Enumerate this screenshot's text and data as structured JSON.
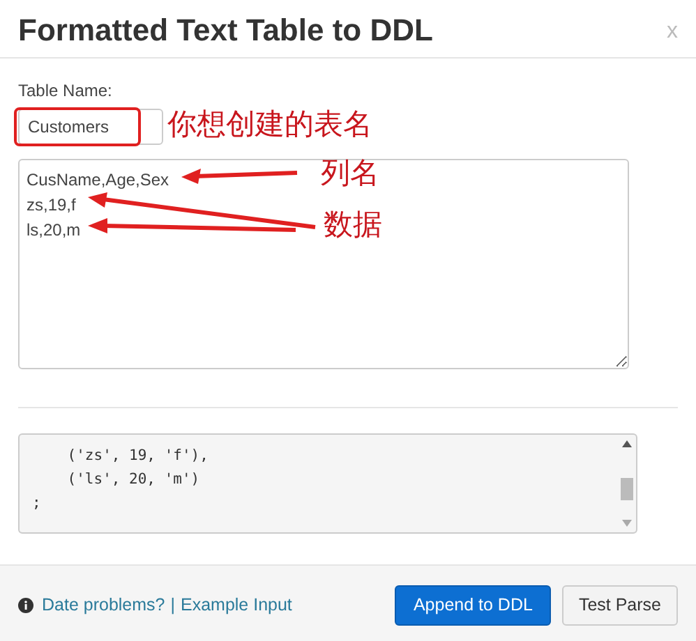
{
  "dialog": {
    "title": "Formatted Text Table to DDL",
    "close": "x"
  },
  "table_name": {
    "label": "Table Name:",
    "value": "Customers"
  },
  "input_text": [
    "CusName,Age,Sex",
    "zs,19,f",
    "ls,20,m"
  ],
  "output_code": [
    "    ('zs', 19, 'f'),",
    "    ('ls', 20, 'm')",
    ";"
  ],
  "footer": {
    "links": [
      "Date problems?",
      "Example Input"
    ],
    "separator": "|"
  },
  "buttons": [
    {
      "label": "Append to DDL",
      "kind": "primary"
    },
    {
      "label": "Test Parse",
      "kind": "secondary"
    }
  ],
  "annotations": [
    {
      "text": "你想创建的表名"
    },
    {
      "text": "列名"
    },
    {
      "text": "数据"
    }
  ]
}
